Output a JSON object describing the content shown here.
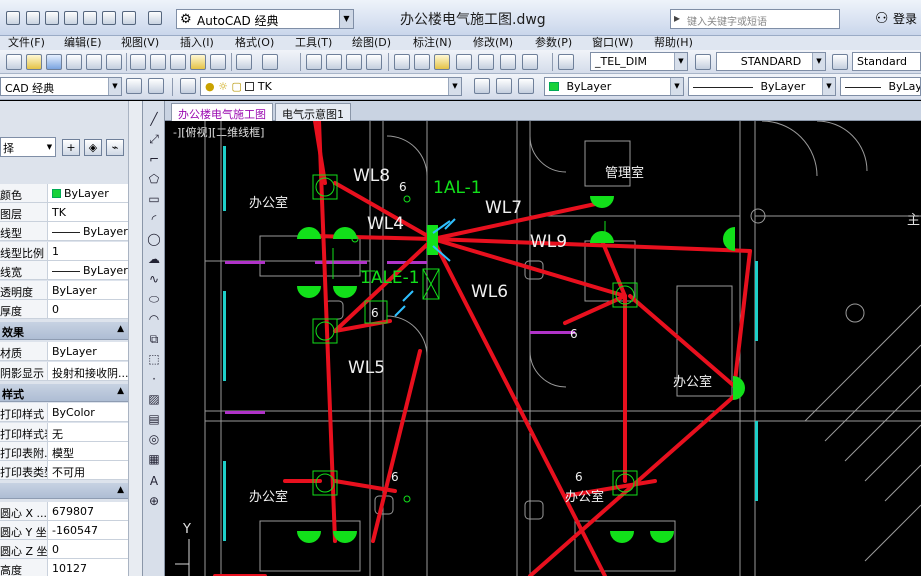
{
  "titlebar": {
    "workspace": "AutoCAD 经典",
    "document_title": "办公楼电气施工图.dwg",
    "search_placeholder": "键入关键字或短语",
    "login": "登录"
  },
  "menu": [
    "文件(F)",
    "编辑(E)",
    "视图(V)",
    "插入(I)",
    "格式(O)",
    "工具(T)",
    "绘图(D)",
    "标注(N)",
    "修改(M)",
    "参数(P)",
    "窗口(W)",
    "帮助(H)"
  ],
  "styles_toolbar": {
    "text_style": "_TEL_DIM",
    "dim_style": "STANDARD",
    "table_style": "Standard"
  },
  "layers_toolbar": {
    "workspace_combo": "CAD 经典",
    "layer": "TK",
    "color": "ByLayer",
    "linetype": "ByLayer",
    "lineweight": "ByLayer"
  },
  "palette": {
    "selection": "择",
    "general_rows": [
      {
        "key": "颜色",
        "value": "ByLayer",
        "swatch": true
      },
      {
        "key": "图层",
        "value": "TK"
      },
      {
        "key": "线型",
        "value": "ByLayer",
        "line": true
      },
      {
        "key": "线型比例",
        "value": "1"
      },
      {
        "key": "线宽",
        "value": "ByLayer",
        "line": true
      },
      {
        "key": "透明度",
        "value": "ByLayer"
      },
      {
        "key": "厚度",
        "value": "0"
      }
    ],
    "cat_3d": "效果",
    "rows_3d": [
      {
        "key": "材质",
        "value": "ByLayer"
      },
      {
        "key": "阴影显示",
        "value": "投射和接收阴..."
      }
    ],
    "cat_plot": "样式",
    "rows_plot": [
      {
        "key": "打印样式",
        "value": "ByColor"
      },
      {
        "key": "打印样式表",
        "value": "无"
      },
      {
        "key": "打印表附...",
        "value": "模型"
      },
      {
        "key": "打印表类型",
        "value": "不可用"
      }
    ],
    "rows_view": [
      {
        "key": "圆心 X ...",
        "value": "679807"
      },
      {
        "key": "圆心 Y 坐...",
        "value": "-160547"
      },
      {
        "key": "圆心 Z 坐...",
        "value": "0"
      },
      {
        "key": "高度",
        "value": "10127"
      }
    ]
  },
  "doc_tabs": [
    "办公楼电气施工图",
    "电气示意图1"
  ],
  "viewport_label": "-][俯视][二维线框]",
  "drawing_labels": {
    "panel": "1AL-1",
    "panel2": "1ALE-1",
    "circuits": [
      "WL8",
      "WL4",
      "WL7",
      "WL9",
      "WL6",
      "WL5"
    ],
    "rooms": [
      "办公室",
      "办公室",
      "管理室",
      "办公室",
      "办公室"
    ],
    "counts": [
      "6",
      "6",
      "6",
      "6",
      "6"
    ],
    "axis_y": "Y",
    "edge_text": "主"
  },
  "colors": {
    "wire": "#e8101e",
    "fixture": "#12e01a",
    "wall_cyan": "#1ecfc9",
    "canvas_bg": "#000000"
  }
}
